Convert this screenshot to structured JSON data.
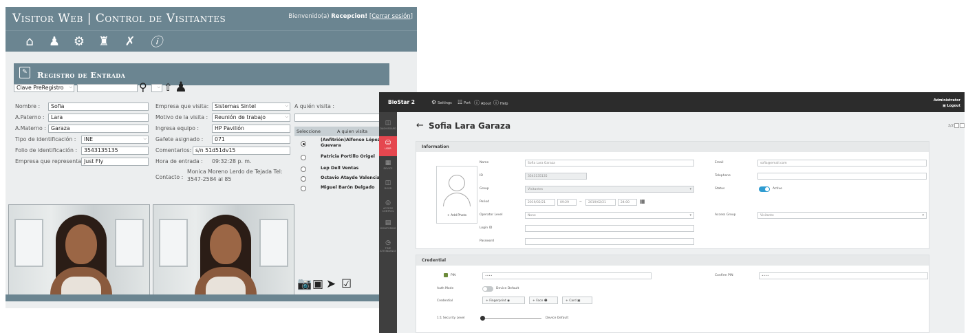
{
  "visitor_web": {
    "title": "Visitor Web | Control de Visitantes",
    "user_greeting": "Bienvenido(a)",
    "user_name": "Recepcion!",
    "logout_open": "[",
    "logout_label": "Cerrar sesión",
    "logout_close": "]",
    "toolbar_icons": [
      "home-icon",
      "visitor-icon",
      "settings-icon",
      "users-icon",
      "tools-icon",
      "info-icon"
    ],
    "panel_title": "Registro de Entrada",
    "prereg_select": "Clave PreRegistro",
    "form": {
      "nombre_label": "Nombre :",
      "nombre": "Sofia",
      "apaterno_label": "A.Paterno :",
      "apaterno": "Lara",
      "amaterno_label": "A.Materno :",
      "amaterno": "Garaza",
      "tipo_id_label": "Tipo de identificación :",
      "tipo_id": "INE",
      "folio_label": "Folio de identificación :",
      "folio": "3543135135",
      "empresa_rep_label": "Empresa que representa:",
      "empresa_rep": "Just Fly",
      "empresa_visita_label": "Empresa que visita:",
      "empresa_visita": "Sistemas Sintel",
      "motivo_label": "Motivo de la visita :",
      "motivo": "Reunión de trabajo",
      "equipo_label": "Ingresa equipo :",
      "equipo": "HP Pavilión",
      "gafete_label": "Gafete asignado :",
      "gafete": "071",
      "comentarios_label": "Comentarios:",
      "comentarios": "s/n 51d51dv15",
      "hora_label": "Hora de entrada :",
      "hora": "09:32:28 p. m.",
      "contacto_label": "Contacto :",
      "contacto_line1": "Monica Moreno Lerdo de Tejada Tel:",
      "contacto_line2": "3547-2584 al 85"
    },
    "visit": {
      "label": "A quién visita :",
      "col_select": "Seleccione",
      "col_name": "A quien visita",
      "rows": [
        {
          "name": "(Anfitrión)Alfonso López Guevara",
          "selected": true
        },
        {
          "name": "Patricia Portillo Origel",
          "selected": false
        },
        {
          "name": "Lep Dell Ventas",
          "selected": false
        },
        {
          "name": "Octavio Atayde Valencia",
          "selected": false
        },
        {
          "name": "Miguel Barón Delgado",
          "selected": false
        }
      ]
    },
    "action_icons": [
      "camera-icon",
      "card-icon",
      "megaphone-icon",
      "check-icon"
    ]
  },
  "biostar": {
    "logo": "BioStar 2",
    "menu": [
      "Settings",
      "Port",
      "About",
      "Help"
    ],
    "admin": "Administrator",
    "logout": "Logout",
    "sidebar": [
      "DASH BOARD",
      "USER",
      "DEVICE",
      "DOOR",
      "ACCESS CONTROL",
      "MONITORING",
      "TIME ATTENDANCE"
    ],
    "active_sidebar": "USER",
    "user_title": "Sofia Lara Garaza",
    "pager": "2/2",
    "info_header": "Information",
    "add_photo": "+ Add Photo",
    "fields": {
      "name_label": "Name",
      "name": "Sofia Lara Garaza",
      "id_label": "ID",
      "id": "3543135135",
      "group_label": "Group",
      "group": "Visitantes",
      "period_label": "Period",
      "period_start_date": "2019/02/21",
      "period_start_time": "09:29",
      "period_sep": "~",
      "period_end_date": "2019/02/21",
      "period_end_time": "24:00",
      "operator_label": "Operator Level",
      "operator": "None",
      "login_label": "Login ID",
      "login": "",
      "password_label": "Password",
      "password": "",
      "email_label": "Email",
      "email": "sofia@email.com",
      "telephone_label": "Telephone",
      "telephone": "",
      "status_label": "Status",
      "status": "Active",
      "access_group_label": "Access Group",
      "access_group": "Visitante"
    },
    "credential_header": "Credential",
    "credential": {
      "pin_label": "PIN",
      "pin": "••••",
      "confirm_pin_label": "Confirm PIN",
      "confirm_pin": "••••",
      "auth_mode_label": "Auth Mode",
      "auth_mode": "Device Default",
      "credential_label": "Credential",
      "fingerprint_btn": "+ Fingerprint",
      "face_btn": "+ Face",
      "card_btn": "+ Card",
      "security_label": "1:1 Security Level",
      "security_value": "Device Default"
    }
  }
}
